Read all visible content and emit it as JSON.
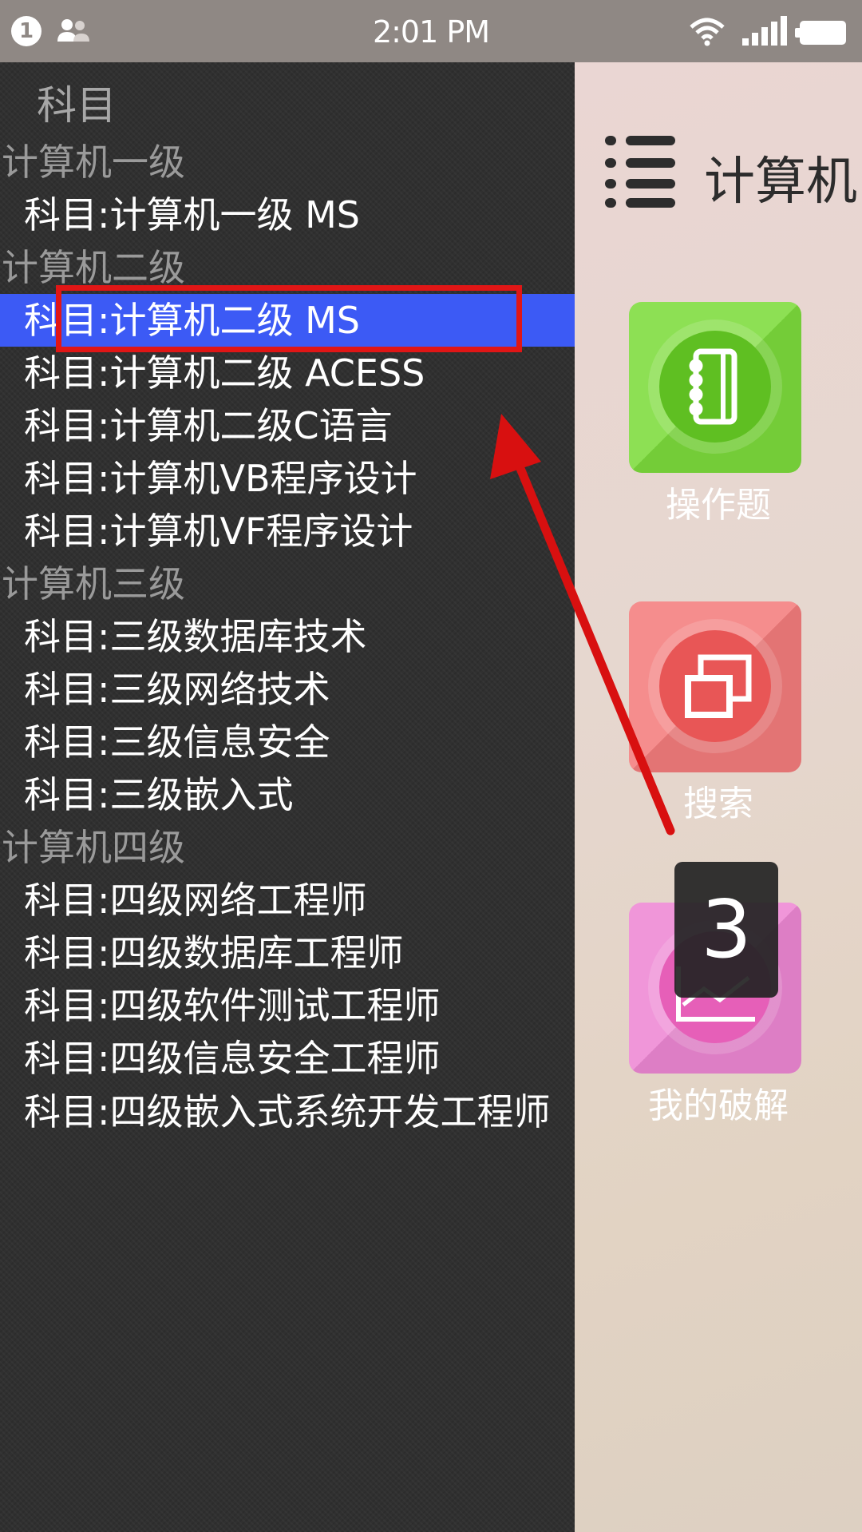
{
  "status_bar": {
    "notification_count": "1",
    "time": "2:01 PM",
    "icons": [
      "notification-badge-icon",
      "contacts-icon",
      "wifi-icon",
      "signal-icon",
      "battery-icon"
    ]
  },
  "drawer": {
    "title": "科目",
    "groups": [
      {
        "label": "计算机一级",
        "items": [
          "科目:计算机一级 MS"
        ]
      },
      {
        "label": "计算机二级",
        "items": [
          "科目:计算机二级 MS",
          "科目:计算机二级 ACESS",
          "科目:计算机二级C语言",
          "科目:计算机VB程序设计",
          "科目:计算机VF程序设计"
        ]
      },
      {
        "label": "计算机三级",
        "items": [
          "科目:三级数据库技术",
          "科目:三级网络技术",
          "科目:三级信息安全",
          "科目:三级嵌入式"
        ]
      },
      {
        "label": "计算机四级",
        "items": [
          "科目:四级网络工程师",
          "科目:四级数据库工程师",
          "科目:四级软件测试工程师",
          "科目:四级信息安全工程师",
          "科目:四级嵌入式系统开发工程师"
        ]
      }
    ],
    "selected_item": "科目:计算机二级 MS"
  },
  "main": {
    "title": "计算机",
    "menu_icon": "menu-list-icon",
    "tiles": [
      {
        "label": "操作题",
        "icon": "notebook-icon",
        "color": "#7ddc3c"
      },
      {
        "label": "搜索",
        "icon": "windows-icon",
        "color": "#f47d7d"
      },
      {
        "label": "我的破解",
        "icon": "chart-icon",
        "color": "#ee88d4"
      }
    ],
    "page_indicator": "3"
  },
  "annotation": {
    "box_color": "#e01616",
    "arrow_color": "#d81010"
  }
}
